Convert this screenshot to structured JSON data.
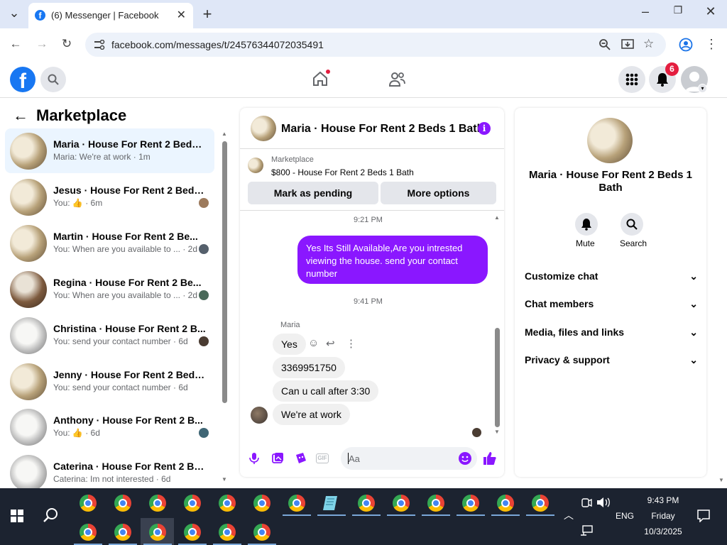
{
  "browser": {
    "tab_title": "(6) Messenger | Facebook",
    "url": "facebook.com/messages/t/24576344072035491"
  },
  "fb_header": {
    "notification_count": "6"
  },
  "left": {
    "title": "Marketplace",
    "conversations": [
      {
        "name": "Maria · House For Rent 2 Beds 1 ...",
        "sub": "Maria: We're at work · 1m",
        "active": true
      },
      {
        "name": "Jesus · House For Rent 2 Beds...",
        "sub": "You: 👍 · 6m"
      },
      {
        "name": "Martin · House For Rent 2 Be...",
        "sub": "You: When are you available to ... · 2d"
      },
      {
        "name": "Regina · House For Rent 2 Be...",
        "sub": "You: When are you available to ... · 2d"
      },
      {
        "name": "Christina · House For Rent 2 B...",
        "sub": "You: send your contact number · 6d"
      },
      {
        "name": "Jenny · House For Rent 2 Beds 1 ...",
        "sub": "You: send your contact number · 6d"
      },
      {
        "name": "Anthony · House For Rent 2 B...",
        "sub": "You: 👍 · 6d"
      },
      {
        "name": "Caterina · House For Rent 2 Bed...",
        "sub": "Caterina: Im not interested · 6d"
      }
    ]
  },
  "chat": {
    "title": "Maria · House For Rent 2 Beds 1 Bath",
    "listing_source": "Marketplace",
    "listing": "$800 - House For Rent 2 Beds 1 Bath",
    "btn_pending": "Mark as pending",
    "btn_more": "More options",
    "time1": "9:21 PM",
    "out_msg": "Yes Its Still Available,Are you intrested viewing the house. send your contact number",
    "time2": "9:41 PM",
    "sender": "Maria",
    "in_msgs": [
      "Yes",
      "3369951750",
      "Can u call after 3:30",
      "We're at work"
    ],
    "input_placeholder": "Aa"
  },
  "details": {
    "title": "Maria · House For Rent 2 Beds 1 Bath",
    "mute": "Mute",
    "search": "Search",
    "sections": [
      "Customize chat",
      "Chat members",
      "Media, files and links",
      "Privacy & support"
    ]
  },
  "taskbar": {
    "time": "9:43 PM",
    "day": "Friday",
    "date": "10/3/2025",
    "lang": "ENG"
  },
  "colors": {
    "fb_blue": "#1877f2",
    "messenger_purple": "#8a17ff",
    "active_row": "#ebf5ff"
  }
}
